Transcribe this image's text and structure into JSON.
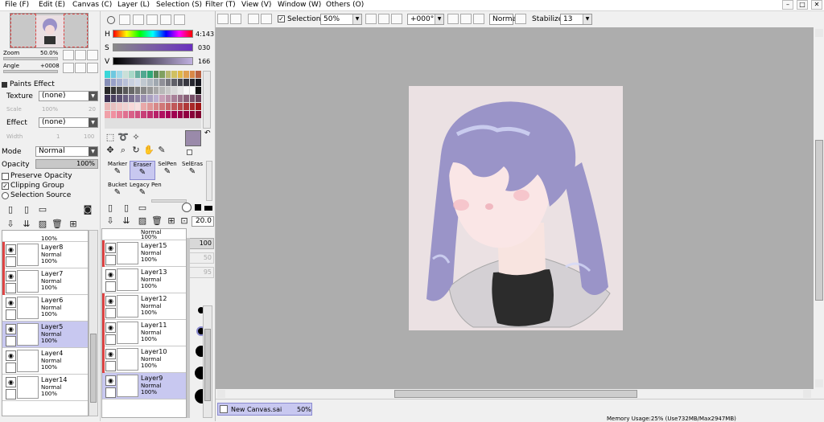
{
  "menu": [
    "File (F)",
    "Edit (E)",
    "Canvas (C)",
    "Layer (L)",
    "Selection (S)",
    "Filter (T)",
    "View (V)",
    "Window (W)",
    "Others (O)"
  ],
  "window_controls": {
    "minimize": "–",
    "restore": "□",
    "close": "✕"
  },
  "toolbar": {
    "selection_label": "Selection",
    "selection_checked": true,
    "zoom": "50%",
    "rotation": "+000°",
    "mode": "Normal",
    "stabilizer_label": "Stabilizer",
    "stabilizer": "13"
  },
  "navigator": {
    "zoom_label": "Zoom",
    "zoom_value": "50.0%",
    "angle_label": "Angle",
    "angle_value": "+0008"
  },
  "paint_effect": {
    "title": "Paints Effect",
    "texture_label": "Texture",
    "texture_value": "(none)",
    "scale_label": "Scale",
    "scale_pct": "100%",
    "scale_num": "20",
    "effect_label": "Effect",
    "effect_value": "(none)",
    "width_label": "Width",
    "width_num": "1",
    "width_max": "100"
  },
  "layer_props": {
    "mode_label": "Mode",
    "mode_value": "Normal",
    "opacity_label": "Opacity",
    "opacity_value": "100%",
    "preserve_opacity": "Preserve Opacity",
    "clipping_group": "Clipping Group",
    "selection_source": "Selection Source"
  },
  "hsv": {
    "h_label": "H",
    "h_value": "4:143",
    "s_label": "S",
    "s_value": "030",
    "v_label": "V",
    "v_value": "166"
  },
  "current_color": "#9a8aaa",
  "palette": [
    "#3ad6d8",
    "#6ec8e0",
    "#a0d8e8",
    "#c8e0d8",
    "#a8d8c8",
    "#68b0a0",
    "#50a890",
    "#30a878",
    "#588858",
    "#80a060",
    "#b8b870",
    "#d0c060",
    "#e0b848",
    "#e0a050",
    "#d88848",
    "#b86040",
    "#8890b8",
    "#98a0c8",
    "#a8b0d0",
    "#b8c0d8",
    "#c8d0e0",
    "#d0d8e8",
    "#c0c8d0",
    "#b0b8c0",
    "#a0a8b0",
    "#909098",
    "#787880",
    "#606068",
    "#484850",
    "#383840",
    "#282830",
    "#181820",
    "#282828",
    "#383838",
    "#484848",
    "#585858",
    "#686868",
    "#787878",
    "#888888",
    "#989898",
    "#a8a8a8",
    "#b8b8b8",
    "#c8c8c8",
    "#d8d8d8",
    "#e8e8e8",
    "#f8f8f8",
    "#ffffff",
    "#101010",
    "#3a3050",
    "#4a4060",
    "#5a5070",
    "#6a6080",
    "#7a7090",
    "#8a80a0",
    "#9a90b0",
    "#aaa0c0",
    "#bab0d0",
    "#c8a0b8",
    "#b890a8",
    "#a88098",
    "#987088",
    "#886078",
    "#785068",
    "#684058",
    "#e8b8b8",
    "#e8c0c0",
    "#f0c8c8",
    "#f0d0d0",
    "#f8d8d8",
    "#f8e0e0",
    "#e8a8a8",
    "#e09898",
    "#d88888",
    "#d07878",
    "#c86868",
    "#c05858",
    "#b84848",
    "#b03838",
    "#a82828",
    "#a01818",
    "#f0a0a8",
    "#f090a0",
    "#e88098",
    "#e07090",
    "#d86088",
    "#d05080",
    "#c84078",
    "#c03070",
    "#b82068",
    "#b01060",
    "#a80058",
    "#a00050",
    "#980048",
    "#900040",
    "#880038",
    "#800030"
  ],
  "tools": [
    {
      "label": "Marker",
      "active": false
    },
    {
      "label": "Eraser",
      "active": true
    },
    {
      "label": "SelPen",
      "active": false
    },
    {
      "label": "SelEras",
      "active": false
    },
    {
      "label": "Bucket",
      "active": false
    },
    {
      "label": "Legacy Pen",
      "active": false
    }
  ],
  "brush": {
    "size": "20.0",
    "dens": "100",
    "v1": "50",
    "v2": "95"
  },
  "layers_left": [
    {
      "name": "",
      "mode": "",
      "opacity": "100%",
      "red": false,
      "active": false,
      "partial": true
    },
    {
      "name": "Layer8",
      "mode": "Normal",
      "opacity": "100%",
      "red": true,
      "active": false
    },
    {
      "name": "Layer7",
      "mode": "Normal",
      "opacity": "100%",
      "red": true,
      "active": false
    },
    {
      "name": "Layer6",
      "mode": "Normal",
      "opacity": "100%",
      "red": false,
      "active": false
    },
    {
      "name": "Layer5",
      "mode": "Normal",
      "opacity": "100%",
      "red": false,
      "active": true
    },
    {
      "name": "Layer4",
      "mode": "Normal",
      "opacity": "100%",
      "red": false,
      "active": false
    },
    {
      "name": "Layer14",
      "mode": "Normal",
      "opacity": "100%",
      "red": false,
      "active": false
    }
  ],
  "layers_right": [
    {
      "name": "",
      "mode": "Normal",
      "opacity": "100%",
      "red": false,
      "partial": true
    },
    {
      "name": "Layer15",
      "mode": "Normal",
      "opacity": "100%",
      "red": true
    },
    {
      "name": "Layer13",
      "mode": "Normal",
      "opacity": "100%",
      "red": false
    },
    {
      "name": "Layer12",
      "mode": "Normal",
      "opacity": "100%",
      "red": true
    },
    {
      "name": "Layer11",
      "mode": "Normal",
      "opacity": "100%",
      "red": true
    },
    {
      "name": "Layer10",
      "mode": "Normal",
      "opacity": "100%",
      "red": true
    },
    {
      "name": "Layer9",
      "mode": "Normal",
      "opacity": "100%",
      "red": false,
      "active": true
    }
  ],
  "status": {
    "tab_name": "New Canvas.sai",
    "tab_zoom": "50%",
    "memory": "Memory Usage:25% (Use732MB/Max2947MB)"
  }
}
